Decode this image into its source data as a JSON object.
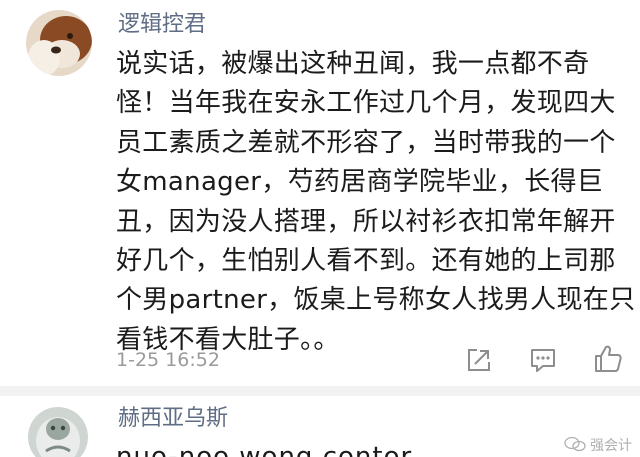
{
  "comments": [
    {
      "username": "逻辑控君",
      "lines": [
        "说实话，被爆出这种丑闻，我一点都不奇",
        "怪！当年我在安永工作过几个月，发现四大",
        "员工素质之差就不形容了，当时带我的一个",
        "女manager，芍药居商学院毕业，长得巨",
        "丑，因为没人搭理，所以衬衫衣扣常年解开",
        "好几个，生怕别人看不到。还有她的上司那",
        "个男partner，饭桌上号称女人找男人现在只",
        "看钱不看大肚子。。"
      ],
      "timestamp": "1-25 16:52",
      "actions": {
        "share_icon": "share-icon",
        "reply_icon": "comment-icon",
        "like_icon": "thumbs-up-icon"
      }
    },
    {
      "username": "赫西亚乌斯",
      "first_line_partial": "nuo-noo wong contor"
    }
  ],
  "watermark": {
    "text": "强会计"
  },
  "colors": {
    "username": "#5f6d85",
    "body_text": "#1b1b1b",
    "timestamp": "#9a9a9a",
    "icon": "#8e8e8e",
    "divider": "#f2f2f2"
  }
}
